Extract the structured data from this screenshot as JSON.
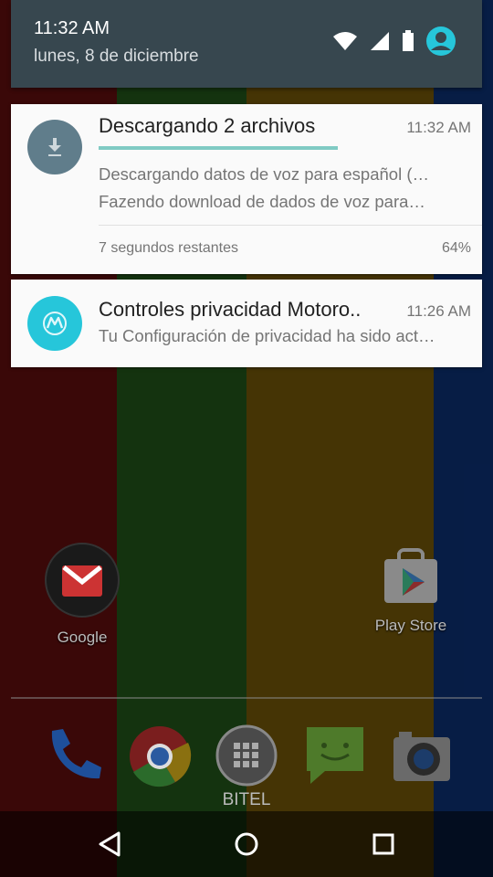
{
  "status_bar": {
    "time": "11:32 AM",
    "date": "lunes, 8 de diciembre",
    "icons": [
      "wifi-icon",
      "signal-icon",
      "battery-icon",
      "user-account-icon"
    ]
  },
  "notifications": [
    {
      "icon": "download-icon",
      "title": "Descargando 2 archivos",
      "time": "11:32 AM",
      "progress": 0.64,
      "lines": [
        "Descargando datos de voz para español (…",
        "Fazendo download de dados de voz para…"
      ],
      "footer_left": "7 segundos restantes",
      "footer_right": "64%"
    },
    {
      "icon": "motorola-icon",
      "title": "Controles privacidad Motoro..",
      "time": "11:26 AM",
      "lines": [
        "Tu Configuración de privacidad ha sido act…"
      ]
    }
  ],
  "home": {
    "apps": [
      {
        "icon": "google-folder-icon",
        "label": "Google"
      },
      {
        "icon": "play-store-icon",
        "label": "Play Store"
      }
    ],
    "dock": [
      {
        "icon": "phone-icon"
      },
      {
        "icon": "chrome-icon"
      },
      {
        "icon": "app-drawer-icon",
        "label": "BITEL"
      },
      {
        "icon": "messaging-icon"
      },
      {
        "icon": "camera-icon"
      }
    ]
  },
  "navigation": [
    "back-icon",
    "home-icon",
    "recents-icon"
  ],
  "colors": {
    "header_bg": "#37474f",
    "progress": "#80cbc4",
    "download_icon_bg": "#607d8b",
    "motorola_icon_bg": "#26c6da"
  }
}
